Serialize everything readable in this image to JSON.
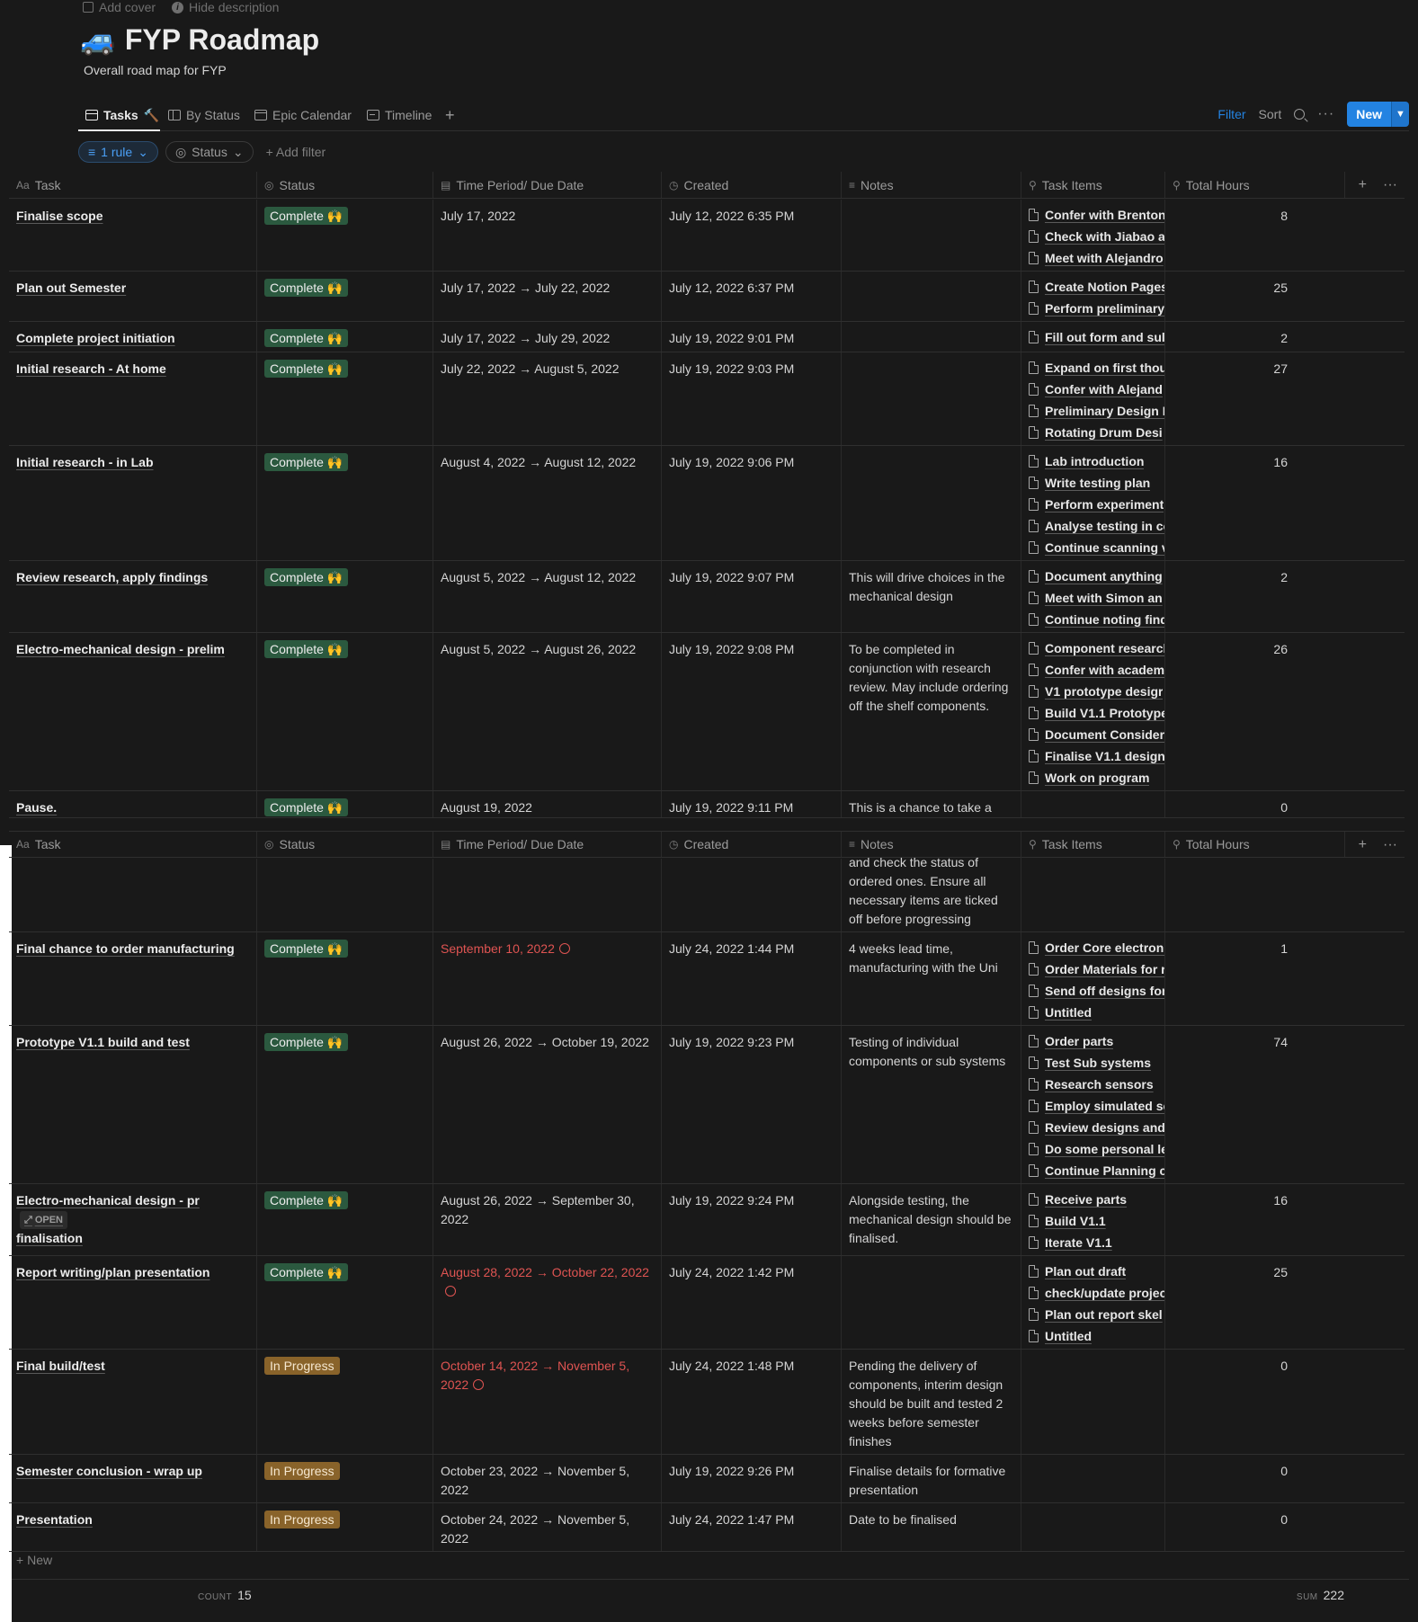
{
  "page": {
    "add_cover": "Add cover",
    "hide_description": "Hide description",
    "icon": "🚙",
    "title": "FYP Roadmap",
    "description": "Overall road map for FYP"
  },
  "views": {
    "tabs": [
      {
        "label": "Tasks",
        "emoji": "🔨",
        "icon": "table-icon",
        "active": true
      },
      {
        "label": "By Status",
        "icon": "board-icon"
      },
      {
        "label": "Epic Calendar",
        "icon": "calendar-icon"
      },
      {
        "label": "Timeline",
        "icon": "timeline-icon"
      }
    ],
    "filter": "Filter",
    "sort": "Sort",
    "new_button": "New"
  },
  "filters": {
    "rule": "1 rule",
    "status": "Status",
    "add_filter": "Add filter"
  },
  "columns": {
    "task": "Task",
    "status": "Status",
    "date": "Time Period/ Due Date",
    "created": "Created",
    "notes": "Notes",
    "items": "Task Items",
    "hours": "Total Hours"
  },
  "rows_top": [
    {
      "task": "Finalise scope",
      "status": "Complete 🙌",
      "date": "July 17, 2022",
      "created": "July 12, 2022 6:35 PM",
      "notes": "",
      "items": [
        "Confer with Brenton",
        "Check with Jiabao ar",
        "Meet with Alejandro"
      ],
      "hours": "8"
    },
    {
      "task": "Plan out Semester",
      "status": "Complete 🙌",
      "date": "July 17, 2022 → July 22, 2022",
      "created": "July 12, 2022 6:37 PM",
      "notes": "",
      "items": [
        "Create Notion Pages",
        "Perform preliminary"
      ],
      "hours": "25"
    },
    {
      "task": "Complete project initiation",
      "status": "Complete 🙌",
      "date": "July 17, 2022 → July 29, 2022",
      "created": "July 19, 2022 9:01 PM",
      "notes": "",
      "items": [
        "Fill out form and sul"
      ],
      "hours": "2"
    },
    {
      "task": "Initial research - At home",
      "status": "Complete 🙌",
      "date": "July 22, 2022 → August 5, 2022",
      "created": "July 19, 2022 9:03 PM",
      "notes": "",
      "items": [
        "Expand on first thou",
        "Confer with Alejand",
        "Preliminary Design I",
        "Rotating Drum Desi"
      ],
      "hours": "27"
    },
    {
      "task": "Initial research - in Lab",
      "status": "Complete 🙌",
      "date": "August 4, 2022 → August 12, 2022",
      "created": "July 19, 2022 9:06 PM",
      "notes": "",
      "items": [
        "Lab introduction",
        "Write testing plan",
        "Perform experiment",
        "Analyse testing in co",
        "Continue scanning v"
      ],
      "hours": "16"
    },
    {
      "task": "Review research, apply findings",
      "status": "Complete 🙌",
      "date": "August 5, 2022 → August 12, 2022",
      "created": "July 19, 2022 9:07 PM",
      "notes": "This will drive choices in the mechanical design",
      "items": [
        "Document anything",
        "Meet with Simon an",
        "Continue noting find"
      ],
      "hours": "2"
    },
    {
      "task": "Electro-mechanical design - prelim",
      "status": "Complete 🙌",
      "date": "August 5, 2022 → August 26, 2022",
      "created": "July 19, 2022 9:08 PM",
      "notes": "To be completed in conjunction with research review. May include ordering off the shelf components.",
      "items": [
        "Component researcl",
        "Confer with academ",
        "V1 prototype desigr",
        "Build V1.1 Prototype",
        "Document Considera",
        "Finalise V1.1 design",
        "Work on program"
      ],
      "hours": "26"
    },
    {
      "task": "Pause.",
      "status": "Complete 🙌",
      "date": "August 19, 2022",
      "created": "July 19, 2022 9:11 PM",
      "notes": "This is a chance to take a",
      "items": [],
      "hours": "0"
    }
  ],
  "continuation_notes": "and check the status of ordered ones. Ensure all necessary items are ticked off before progressing further.",
  "rows_bottom": [
    {
      "task": "Final chance to order manufacturing",
      "status": "Complete 🙌",
      "date": "September 10, 2022",
      "date_overdue": true,
      "created": "July 24, 2022 1:44 PM",
      "notes": "4 weeks lead time, manufacturing with the Uni",
      "items": [
        "Order Core electroni",
        "Order Materials for r",
        "Send off designs for",
        "Untitled"
      ],
      "hours": "1"
    },
    {
      "task": "Prototype V1.1 build and test",
      "status": "Complete 🙌",
      "date": "August 26, 2022 → October 19, 2022",
      "created": "July 19, 2022 9:23 PM",
      "notes": "Testing of individual components or sub systems",
      "items": [
        "Order parts",
        "Test Sub systems",
        "Research sensors",
        "Employ simulated se",
        "Review designs and",
        "Do some personal le",
        "Continue Planning c"
      ],
      "hours": "74"
    },
    {
      "task": "Electro-mechanical design - pr",
      "task2": "finalisation",
      "open": "OPEN",
      "status": "Complete 🙌",
      "date": "August 26, 2022 → September 30, 2022",
      "created": "July 19, 2022 9:24 PM",
      "notes": "Alongside testing, the mechanical design should be finalised.",
      "items": [
        "Receive parts",
        "Build V1.1",
        "Iterate V1.1"
      ],
      "hours": "16"
    },
    {
      "task": "Report writing/plan presentation",
      "status": "Complete 🙌",
      "date": "August 28, 2022 → October 22, 2022",
      "date_overdue": true,
      "created": "July 24, 2022 1:42 PM",
      "notes": "",
      "items": [
        "Plan out draft",
        "check/update projec",
        "Plan out report skel",
        "Untitled"
      ],
      "hours": "25"
    },
    {
      "task": "Final build/test",
      "status": "In Progress",
      "date": "October 14, 2022 → November 5, 2022",
      "date_overdue": true,
      "created": "July 24, 2022 1:48 PM",
      "notes": "Pending the delivery of components, interim design should be built and tested 2 weeks before semester finishes",
      "items": [],
      "hours": "0"
    },
    {
      "task": "Semester conclusion - wrap up",
      "status": "In Progress",
      "date": "October 23, 2022 → November 5, 2022",
      "created": "July 19, 2022 9:26 PM",
      "notes": "Finalise details for formative presentation",
      "items": [],
      "hours": "0"
    },
    {
      "task": "Presentation",
      "status": "In Progress",
      "date": "October 24, 2022 → November 5, 2022",
      "created": "July 24, 2022 1:47 PM",
      "notes": "Date to be finalised",
      "items": [],
      "hours": "0"
    }
  ],
  "footer": {
    "new_label": "New",
    "count_label": "COUNT",
    "count_value": "15",
    "sum_label": "SUM",
    "sum_value": "222"
  },
  "colors": {
    "background": "#191919",
    "accent": "#2383e2",
    "complete_badge": "#2b593f",
    "progress_badge": "#89632a",
    "overdue_text": "#df5452"
  }
}
